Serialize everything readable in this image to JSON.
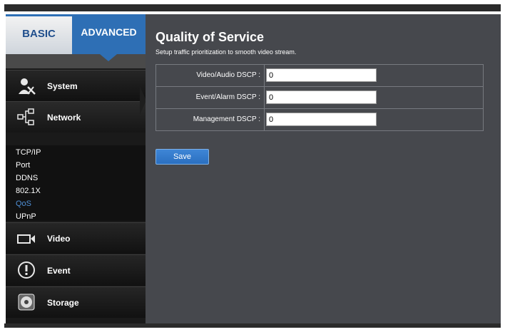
{
  "tabs": {
    "basic": "BASIC",
    "advanced": "ADVANCED"
  },
  "sidebar": {
    "items": [
      {
        "label": "System",
        "icon": "system-tools-icon"
      },
      {
        "label": "Network",
        "icon": "network-icon"
      },
      {
        "label": "Video",
        "icon": "video-camera-icon"
      },
      {
        "label": "Event",
        "icon": "alert-icon"
      },
      {
        "label": "Storage",
        "icon": "disk-icon"
      }
    ],
    "network_subitems": [
      {
        "label": "TCP/IP"
      },
      {
        "label": "Port"
      },
      {
        "label": "DDNS"
      },
      {
        "label": "802.1X"
      },
      {
        "label": "QoS"
      },
      {
        "label": "UPnP"
      }
    ],
    "selected_subitem": "QoS"
  },
  "main": {
    "title": "Quality of Service",
    "subtitle": "Setup traffic prioritization to smooth video stream.",
    "fields": [
      {
        "label": "Video/Audio DSCP :",
        "value": "0"
      },
      {
        "label": "Event/Alarm DSCP :",
        "value": "0"
      },
      {
        "label": "Management DSCP :",
        "value": "0"
      }
    ],
    "save_label": "Save"
  },
  "colors": {
    "accent": "#2e6fb5",
    "selected_link": "#4f8fd6",
    "panel_bg": "#46484d",
    "sidebar_bg": "#1a1a1a"
  }
}
